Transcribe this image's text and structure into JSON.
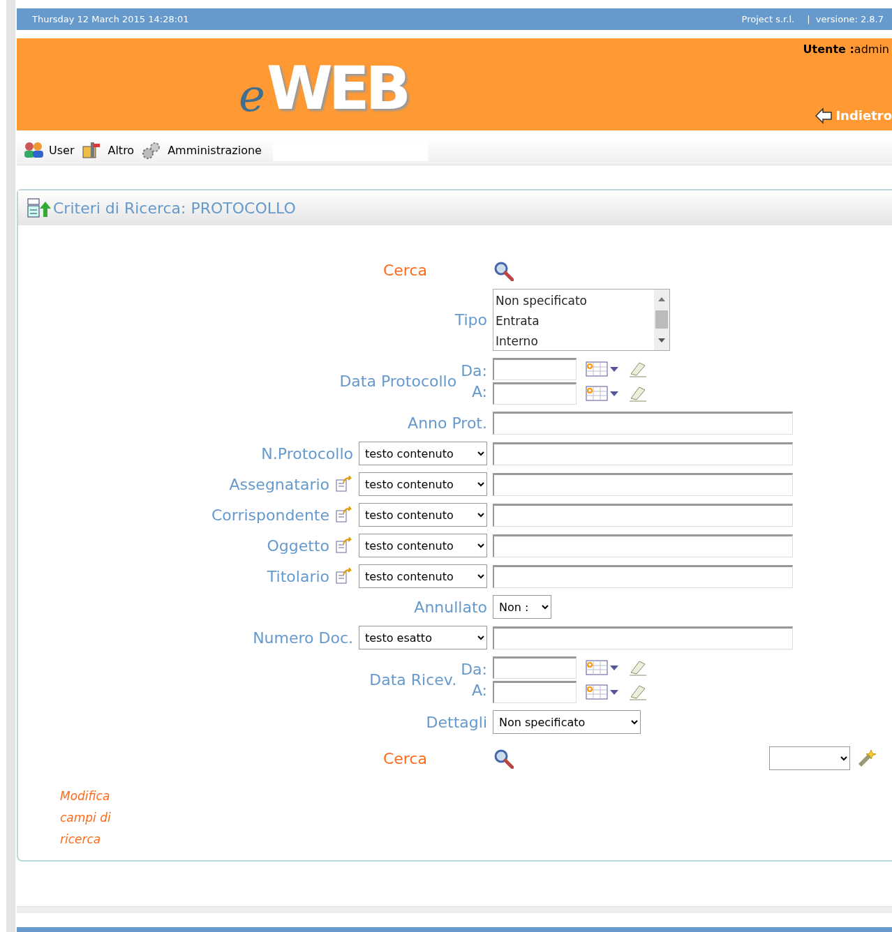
{
  "top_bar": {
    "datetime": "Thursday 12 March 2015 14:28:01",
    "company": "Project s.r.l.",
    "version": "|  versione: 2.8.7"
  },
  "header": {
    "logo_prefix": "e",
    "logo_main": "WEB",
    "user": "**Utente :**admin",
    "back": "Indietro"
  },
  "menu": [
    {
      "label": "User",
      "kind": "users"
    },
    {
      "label": "Altro",
      "kind": "tools"
    },
    {
      "label": "Amministrazione",
      "kind": "gears"
    }
  ],
  "panel": {
    "title": "Criteri di Ricerca: PROTOCOLLO"
  },
  "form": [
    {
      "kind": "search",
      "label": "Cerca"
    },
    {
      "kind": "listbox",
      "label": "Tipo",
      "options": [
        "Non specificato",
        "Entrata",
        "Interno"
      ]
    },
    {
      "kind": "date_range",
      "label": "Data Protocollo",
      "from_label": "Da:",
      "to_label": "A:"
    },
    {
      "kind": "text",
      "label": "Anno Prot."
    },
    {
      "kind": "select_text",
      "label": "N.Protocollo",
      "select": "testo contenuto",
      "lookup": false
    },
    {
      "kind": "select_text",
      "label": "Assegnatario",
      "select": "testo contenuto",
      "lookup": true
    },
    {
      "kind": "select_text",
      "label": "Corrispondente",
      "select": "testo contenuto",
      "lookup": true
    },
    {
      "kind": "select_text",
      "label": "Oggetto",
      "select": "testo contenuto",
      "lookup": true
    },
    {
      "kind": "select_text",
      "label": "Titolario",
      "select": "testo contenuto",
      "lookup": true
    },
    {
      "kind": "select",
      "label": "Annullato",
      "select": "Non :"
    },
    {
      "kind": "select_text",
      "label": "Numero Doc.",
      "select": "testo esatto",
      "lookup": false
    },
    {
      "kind": "date_range",
      "label": "Data Ricev.",
      "from_label": "Da:",
      "to_label": "A:"
    },
    {
      "kind": "select_wide",
      "label": "Dettagli",
      "select": "Non specificato"
    },
    {
      "kind": "search_tools",
      "label": "Cerca"
    }
  ],
  "note": "Modifica campi di ricerca"
}
